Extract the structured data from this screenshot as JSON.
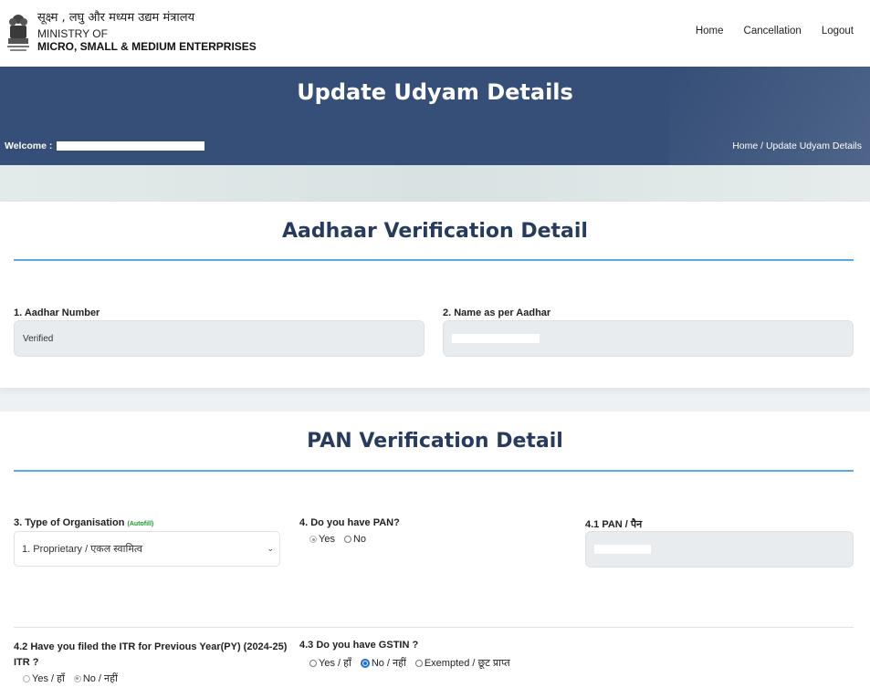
{
  "header": {
    "brand_hindi": "सूक्ष्म , लघु और मध्यम उद्यम मंत्रालय",
    "brand_line2": "MINISTRY OF",
    "brand_line3": "MICRO, SMALL & MEDIUM ENTERPRISES",
    "nav": [
      "Home",
      "Cancellation",
      "Logout"
    ]
  },
  "banner": {
    "title": "Update Udyam Details",
    "welcome_label": "Welcome :",
    "breadcrumb": "Home / Update Udyam Details"
  },
  "aadhaar": {
    "section_title": "Aadhaar Verification Detail",
    "aadhar_number_label": "1. Aadhar Number",
    "aadhar_number_value": "Verified",
    "name_label": "2. Name as per Aadhar"
  },
  "pan": {
    "section_title": "PAN Verification Detail",
    "org_label": "3. Type of Organisation",
    "org_autofill": "(Autofill)",
    "org_value": "1. Proprietary / एकल स्वामित्व",
    "have_pan_label": "4. Do you have PAN?",
    "have_pan_options": [
      "Yes",
      "No"
    ],
    "pan_label": "4.1 PAN / पैन",
    "itr_label": "4.2 Have you filed the ITR for Previous Year(PY) (2024-25) ITR ?",
    "itr_options": [
      "Yes / हाँ",
      "No / नहीं"
    ],
    "gstin_label": "4.3 Do you have GSTIN ?",
    "gstin_options": [
      "Yes / हाँ",
      "No / नहीं",
      "Exempted / छूट प्राप्त"
    ]
  },
  "colors": {
    "banner": "#364f78",
    "section_title": "#263b5e",
    "rule": "#5aa9e6",
    "autofill": "#1a9a2a"
  }
}
